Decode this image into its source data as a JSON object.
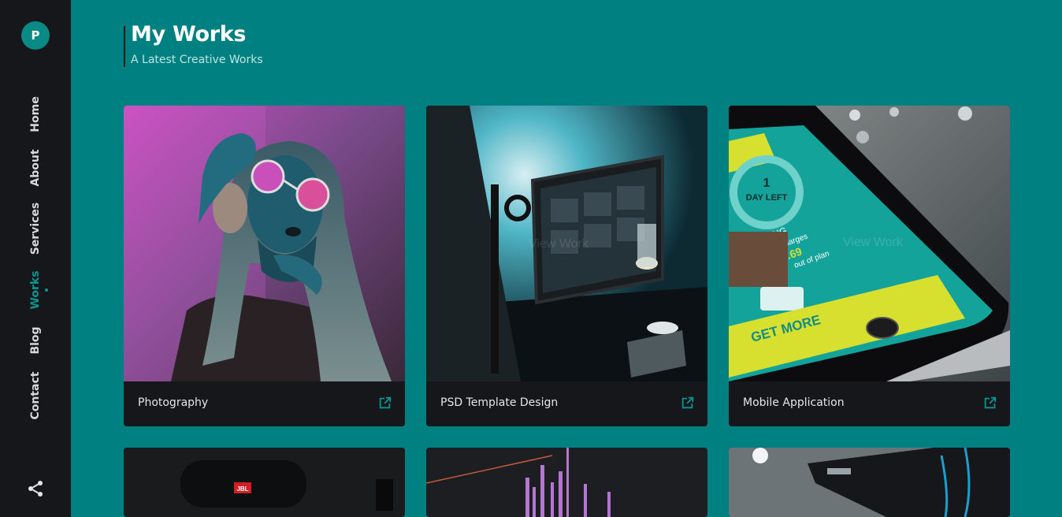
{
  "brand": {
    "logo_letter": "P"
  },
  "nav": {
    "items": [
      {
        "label": "Home",
        "active": false
      },
      {
        "label": "About",
        "active": false
      },
      {
        "label": "Services",
        "active": false
      },
      {
        "label": "Works",
        "active": true
      },
      {
        "label": "Blog",
        "active": false
      },
      {
        "label": "Contact",
        "active": false
      }
    ],
    "share_icon": "share-icon"
  },
  "header": {
    "title": "My Works",
    "subtitle": "A Latest Creative Works"
  },
  "works": [
    {
      "title": "Photography",
      "icon": "external-link-icon"
    },
    {
      "title": "PSD Template Design",
      "icon": "external-link-icon"
    },
    {
      "title": "Mobile Application",
      "icon": "external-link-icon"
    },
    {
      "title": "",
      "icon": ""
    },
    {
      "title": "",
      "icon": ""
    },
    {
      "title": "",
      "icon": ""
    }
  ],
  "overlay_text": {
    "view_work": "View Work"
  },
  "image_text": {
    "phone_day": "1",
    "phone_day_left": "DAY LEFT",
    "phone_billing": "BILLING",
    "phone_new_charges": "New charges",
    "phone_amount": "£8.69",
    "phone_out_of_plan": "out of plan",
    "phone_get_more": "GET MORE",
    "speaker_brand": "JBL"
  },
  "colors": {
    "background": "#008080",
    "sidebar": "#16171b",
    "accent": "#0a9590",
    "card_footer": "#16171b"
  }
}
